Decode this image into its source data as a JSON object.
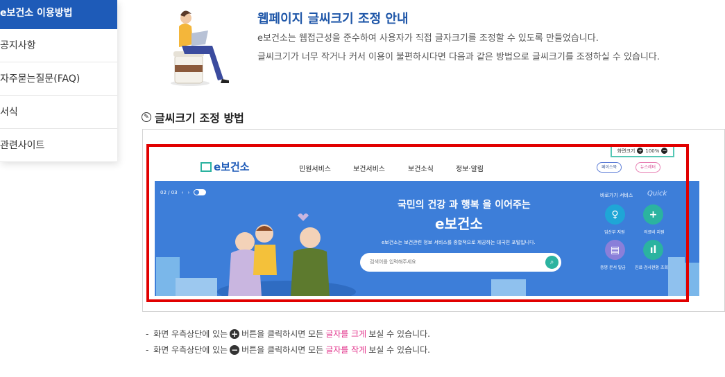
{
  "sidebar": {
    "items": [
      {
        "label": "e보건소 이용방법",
        "active": true
      },
      {
        "label": "공지사항"
      },
      {
        "label": "자주묻는질문(FAQ)"
      },
      {
        "label": "서식"
      },
      {
        "label": "관련사이트"
      }
    ]
  },
  "intro": {
    "title": "웹페이지 글씨크기 조정 안내",
    "line1": "e보건소는 웹접근성을 준수하여 사용자가 직접 글자크기를 조정할 수 있도록 만들었습니다.",
    "line2": "글씨크기가 너무 작거나 커서 이용이 불편하시다면 다음과 같은 방법으로 글씨크기를 조정하실 수 있습니다."
  },
  "section_title": "글씨크기 조정 방법",
  "preview": {
    "logo": "e보건소",
    "nav": [
      "민원서비스",
      "보건서비스",
      "보건소식",
      "정보·알림"
    ],
    "font_control": {
      "label": "화면크기",
      "zoom": "100%"
    },
    "pills": {
      "facebook": "페이스북",
      "newsletter": "뉴스레터"
    },
    "pager": "02 / 03",
    "slogan": "국민의 건강 과 행복 을 이어주는",
    "brand": "e보건소",
    "desc": "e보건소는 보건관련 정보 서비스를 종합적으로 제공하는 대국민 포털입니다.",
    "search_placeholder": "검색어를 입력해주세요",
    "quick_title": "바로가기 서비스",
    "quick_script": "Quick",
    "quick_items": [
      {
        "label": "임산부 지원",
        "color": "#1fa6d6"
      },
      {
        "label": "의료비 지원",
        "color": "#2bb3a0"
      },
      {
        "label": "증명 문서 발급",
        "color": "#8a7fd9"
      },
      {
        "label": "진료·검사현황 조회",
        "color": "#2bb3a0"
      }
    ]
  },
  "notes": [
    {
      "prefix": "화면 우측상단에 있는",
      "icon": "+",
      "mid": "버튼을 클릭하시면 모든",
      "emph": "글자를 크게",
      "suffix": "보실 수 있습니다."
    },
    {
      "prefix": "화면 우측상단에 있는",
      "icon": "−",
      "mid": "버튼을 클릭하시면 모든",
      "emph": "글자를 작게",
      "suffix": "보실 수 있습니다."
    }
  ],
  "colors": {
    "accent": "#1e5bb8",
    "highlight_red": "#e10000",
    "pink": "#e2338b",
    "teal": "#2bb3a0",
    "banner": "#3d7ed9"
  }
}
